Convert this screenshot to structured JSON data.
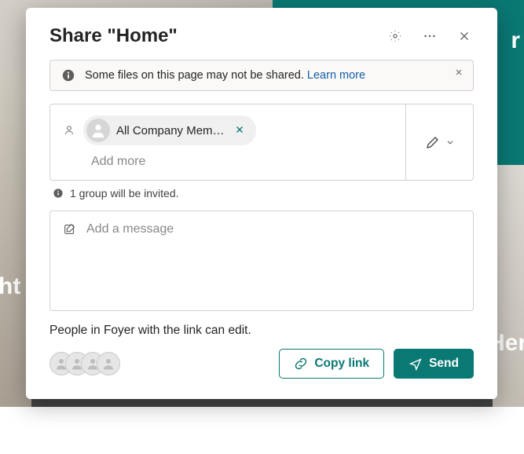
{
  "background": {
    "text_right_top": "r",
    "text_left": "ht",
    "text_right_bottom": "Her"
  },
  "modal": {
    "title": "Share \"Home\"",
    "info": {
      "text": "Some files on this page may not be shared.",
      "link": "Learn more"
    },
    "recipients": {
      "chip_label": "All Company Mem…",
      "add_more_placeholder": "Add more"
    },
    "invite_note": "1 group will be invited.",
    "message_placeholder": "Add a message",
    "permission_text": "People in Foyer with the link can edit.",
    "buttons": {
      "copy": "Copy link",
      "send": "Send"
    }
  }
}
